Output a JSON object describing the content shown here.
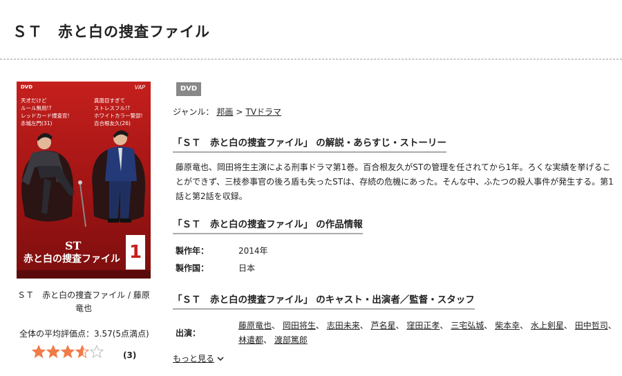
{
  "title": "ＳＴ　赤と白の捜査ファイル",
  "cover": {
    "dvd_mark": "DVD",
    "vap_mark": "VAP",
    "left_text": "天才だけど\nルール無用!?\nレッドカード捜査官!\n赤城左門(31)",
    "right_text": "真面目すぎて\nストレスフル!?\nホワイトカラー警部!\n百合根友久(26)",
    "st": "ST",
    "logo": "赤と白の捜査ファイル",
    "vol": "1"
  },
  "caption": "ＳＴ　赤と白の捜査ファイル / 藤原竜也",
  "rating": {
    "label": "全体の平均評価点：3.57(5点満点)",
    "value": 3.57,
    "max": 5,
    "count": "(3)",
    "star_color": "#f07c47"
  },
  "badge": "DVD",
  "genre": {
    "label": "ジャンル：",
    "link1": "邦画",
    "sep": ">",
    "link2": "TVドラマ"
  },
  "synopsis": {
    "heading": "「ＳＴ　赤と白の捜査ファイル」 の解説・あらすじ・ストーリー",
    "text": "藤原竜也、岡田将生主演による刑事ドラマ第1巻。百合根友久がSTの管理を任されてから1年。ろくな実績を挙げることができず、三枝参事官の後ろ盾も失ったSTは、存続の危機にあった。そんな中、ふたつの殺人事件が発生する。第1話と第2話を収録。"
  },
  "info": {
    "heading": "「ＳＴ　赤と白の捜査ファイル」 の作品情報",
    "year_label": "製作年：",
    "year": "2014年",
    "country_label": "製作国：",
    "country": "日本"
  },
  "cast": {
    "heading": "「ＳＴ　赤と白の捜査ファイル」 のキャスト・出演者／監督・スタッフ",
    "label": "出演：",
    "names": [
      "藤原竜也",
      "岡田将生",
      "志田未来",
      "芦名星",
      "窪田正孝",
      "三宅弘城",
      "柴本幸",
      "水上剣星",
      "田中哲司",
      "林遣都",
      "渡部篤郎"
    ],
    "separator": "、",
    "more": "もっと見る"
  }
}
